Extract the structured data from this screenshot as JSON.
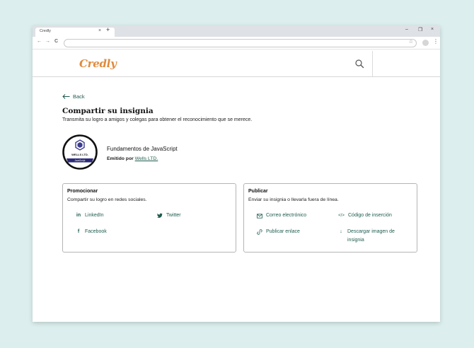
{
  "browser": {
    "tab_title": "Credly",
    "tab_close": "×",
    "new_tab": "+",
    "controls": {
      "minimize": "–",
      "restore": "❐",
      "close": "×"
    },
    "nav": {
      "back": "←",
      "forward": "→",
      "reload": "C"
    },
    "star": "☆",
    "menu": "⋮"
  },
  "header": {
    "logo": "Credly",
    "search_icon": "search-icon"
  },
  "page": {
    "back_label": "Back",
    "title": "Compartir su insignia",
    "subtitle": "Transmita su logro a amigos y colegas para obtener el reconocimiento que se merece."
  },
  "badge": {
    "name": "Fundamentos de JavaScript",
    "issued_by_prefix": "Emitido por",
    "issuer": "Wells LTD.",
    "emblem_text": "WELLS LTD.",
    "ribbon_text": "JavaScript",
    "colors": {
      "ring": "#111111",
      "ribbon": "#2b2a77",
      "hex": "#3c3b8f"
    }
  },
  "promote": {
    "title": "Promocionar",
    "subtitle": "Compartir su logro en redes sociales.",
    "options": [
      {
        "label": "LinkedIn",
        "icon": "in"
      },
      {
        "label": "Twitter",
        "icon": "🐦"
      },
      {
        "label": "Facebook",
        "icon": "f"
      }
    ]
  },
  "publish": {
    "title": "Publicar",
    "subtitle": "Enviar su insignia o llevarla fuera de línea.",
    "options": [
      {
        "label": "Correo electrónico",
        "icon": "✉"
      },
      {
        "label": "Código de inserción",
        "icon": "</>"
      },
      {
        "label": "Publicar enlace",
        "icon": "🔗"
      },
      {
        "label": "Descargar imagen de insignia",
        "icon": "↓"
      }
    ]
  },
  "colors": {
    "accent": "#1f5c4f",
    "logo": "#e08a3c",
    "background": "#dcefee"
  }
}
